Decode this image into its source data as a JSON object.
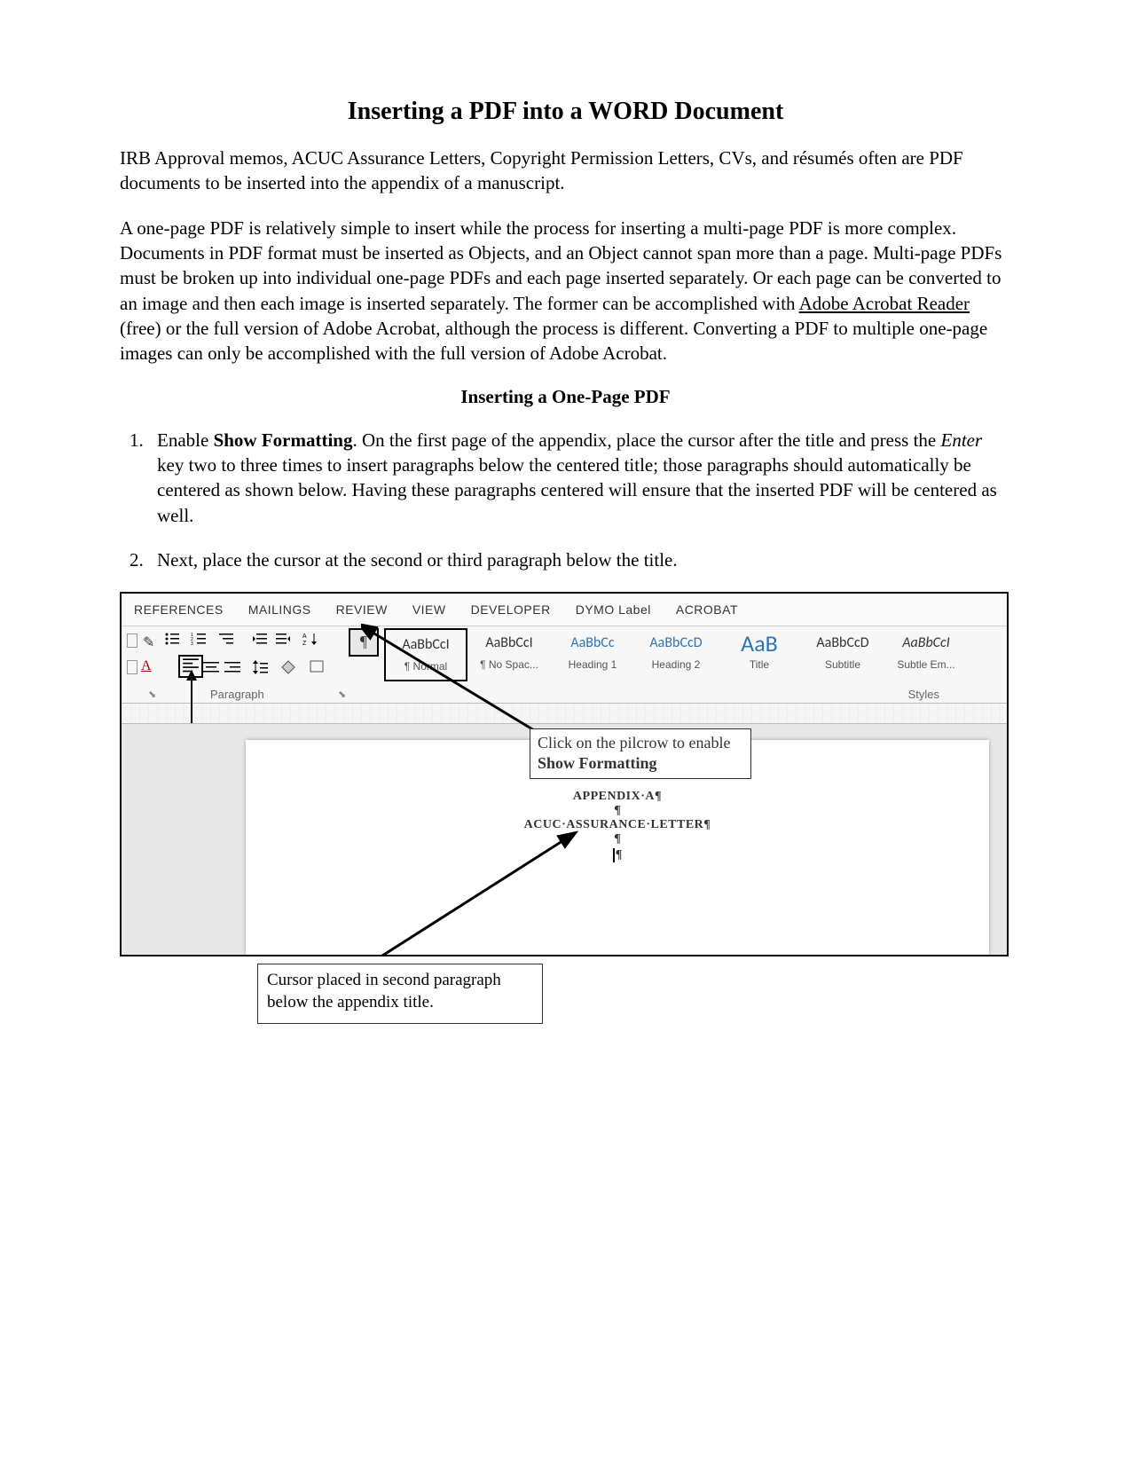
{
  "title": "Inserting a PDF into a WORD Document",
  "intro1": "IRB Approval memos, ACUC Assurance Letters, Copyright Permission Letters, CVs, and résumés often are PDF documents to be inserted into the appendix of a manuscript.",
  "intro2a": "A one-page PDF is relatively simple to insert while the process for inserting a multi-page PDF is more complex. Documents in PDF format must be inserted as Objects, and an Object cannot span more than a page. Multi-page PDFs must be broken up into individual one-page PDFs and each page inserted separately. Or each page can be converted to an image and then each image is inserted separately. The former can be accomplished with ",
  "intro2_link": "Adobe Acrobat Reader",
  "intro2b": " (free) or the full version of Adobe Acrobat, although the process is different. Converting a PDF to multiple one-page images can only be accomplished with the full version of Adobe Acrobat.",
  "section1_head": "Inserting a One-Page PDF",
  "step1_a": "Enable ",
  "step1_b": "Show Formatting",
  "step1_c": ". On the first page of the appendix, place the cursor after the title and press the ",
  "step1_d": "Enter",
  "step1_e": " key two to three times to insert paragraphs below the centered title; those paragraphs should automatically be centered as shown below. Having these paragraphs centered will ensure that the inserted PDF will be centered as well.",
  "step2": "Next, place the cursor at the second or third paragraph below the title.",
  "ribbon": {
    "tabs": [
      "REFERENCES",
      "MAILINGS",
      "REVIEW",
      "VIEW",
      "DEVELOPER",
      "DYMO Label",
      "ACROBAT"
    ],
    "pilcrow": "¶",
    "group_paragraph": "Paragraph",
    "group_styles": "Styles",
    "styles": [
      {
        "sample": "AaBbCcI",
        "label": "¶ Normal",
        "cls": "normal"
      },
      {
        "sample": "AaBbCcI",
        "label": "¶ No Spac...",
        "cls": ""
      },
      {
        "sample": "AaBbCc",
        "label": "Heading 1",
        "cls": "h1"
      },
      {
        "sample": "AaBbCcD",
        "label": "Heading 2",
        "cls": "h2"
      },
      {
        "sample": "AaB",
        "label": "Title",
        "cls": "title"
      },
      {
        "sample": "AaBbCcD",
        "label": "Subtitle",
        "cls": ""
      },
      {
        "sample": "AaBbCcI",
        "label": "Subtle Em...",
        "cls": "se"
      }
    ]
  },
  "callout1_a": "Click on the pilcrow to enable ",
  "callout1_b": "Show Formatting",
  "doc": {
    "line1": "APPENDIX·A¶",
    "line2": "ACUC·ASSURANCE·LETTER¶"
  },
  "callout2": "Cursor placed in second paragraph below the appendix title."
}
